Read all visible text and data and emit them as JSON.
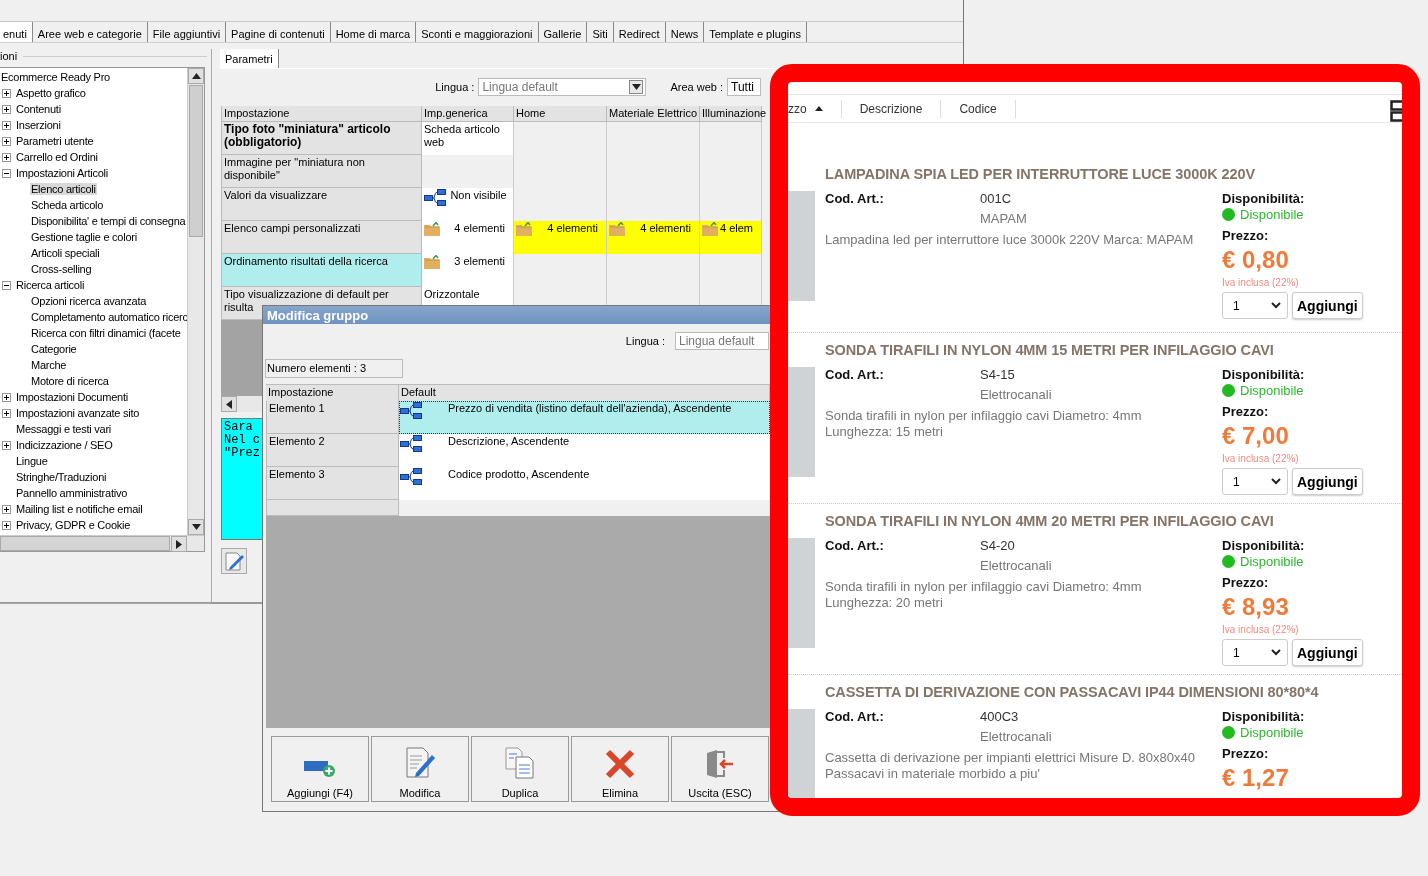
{
  "main_tabs": [
    {
      "label": "enuti",
      "selected": true
    },
    {
      "label": "Aree web e categorie",
      "selected": false
    },
    {
      "label": "File aggiuntivi",
      "selected": false
    },
    {
      "label": "Pagine di contenuti",
      "selected": false
    },
    {
      "label": "Home di marca",
      "selected": false
    },
    {
      "label": "Sconti e maggiorazioni",
      "selected": false
    },
    {
      "label": "Gallerie",
      "selected": false
    },
    {
      "label": "Siti",
      "selected": false
    },
    {
      "label": "Redirect",
      "selected": false
    },
    {
      "label": "News",
      "selected": false
    },
    {
      "label": "Template e plugins",
      "selected": false
    }
  ],
  "tree": {
    "group_label": "ioni",
    "items": [
      {
        "label": "Ecommerce Ready Pro",
        "selected": false,
        "children": [
          {
            "label": "Aspetto grafico",
            "selected": false,
            "expanded": false
          },
          {
            "label": "Contenuti",
            "selected": false,
            "expanded": false
          },
          {
            "label": "Inserzioni",
            "selected": false,
            "expanded": false
          },
          {
            "label": "Parametri utente",
            "selected": false,
            "expanded": false
          },
          {
            "label": "Carrello ed Ordini",
            "selected": false,
            "expanded": false
          },
          {
            "label": "Impostazioni Articoli",
            "selected": false,
            "expanded": true,
            "children": [
              {
                "label": "Elenco articoli",
                "selected": true
              },
              {
                "label": "Scheda articolo",
                "selected": false
              },
              {
                "label": "Disponibilita' e tempi di consegna",
                "selected": false
              },
              {
                "label": "Gestione taglie e colori",
                "selected": false
              },
              {
                "label": "Articoli speciali",
                "selected": false
              },
              {
                "label": "Cross-selling",
                "selected": false
              }
            ]
          },
          {
            "label": "Ricerca articoli",
            "selected": false,
            "expanded": true,
            "children": [
              {
                "label": "Opzioni ricerca avanzata",
                "selected": false
              },
              {
                "label": "Completamento automatico ricerc",
                "selected": false
              },
              {
                "label": "Ricerca con filtri dinamici (facete",
                "selected": false
              },
              {
                "label": "Categorie",
                "selected": false
              },
              {
                "label": "Marche",
                "selected": false
              },
              {
                "label": "Motore di ricerca",
                "selected": false
              }
            ]
          },
          {
            "label": "Impostazioni Documenti",
            "selected": false,
            "expanded": false
          },
          {
            "label": "Impostazioni avanzate sito",
            "selected": false,
            "expanded": false
          },
          {
            "label": "Messaggi e testi vari",
            "selected": false
          },
          {
            "label": "Indicizzazione / SEO",
            "selected": false,
            "expanded": false
          },
          {
            "label": "Lingue",
            "selected": false
          },
          {
            "label": "Stringhe/Traduzioni",
            "selected": false
          },
          {
            "label": "Pannello amministrativo",
            "selected": false
          },
          {
            "label": "Mailing list e notifiche email",
            "selected": false,
            "expanded": false
          },
          {
            "label": "Privacy, GDPR e Cookie",
            "selected": false,
            "expanded": false
          }
        ]
      }
    ]
  },
  "settings": {
    "tab": {
      "label": "Parametri",
      "selected": true
    },
    "language_label": "Lingua :",
    "language": "Lingua default",
    "web_area_label": "Area web :",
    "web_area": "Tutti",
    "columns": [
      "Impostazione",
      "Imp.generica",
      "Home",
      "Materiale Elettrico",
      "Illuminazione"
    ],
    "rows": [
      {
        "cells": [
          {
            "kind": "setting",
            "text": "Tipo foto \"miniatura\" articolo (obbligatorio)",
            "bold": true,
            "selected": false
          },
          {
            "kind": "text",
            "text": "Scheda articolo web",
            "highlighted": false
          },
          {
            "kind": "empty",
            "highlighted": false
          },
          {
            "kind": "empty",
            "highlighted": false
          },
          {
            "kind": "empty",
            "highlighted": false
          }
        ]
      },
      {
        "cells": [
          {
            "kind": "setting",
            "text": "Immagine per \"miniatura non disponibile\"",
            "bold": false,
            "selected": false
          },
          {
            "kind": "empty",
            "highlighted": false
          },
          {
            "kind": "empty",
            "highlighted": false
          },
          {
            "kind": "empty",
            "highlighted": false
          },
          {
            "kind": "empty",
            "highlighted": false
          }
        ]
      },
      {
        "cells": [
          {
            "kind": "setting",
            "text": "Valori da visualizzare",
            "bold": false,
            "selected": false
          },
          {
            "kind": "tree",
            "text": "Non visibile",
            "highlighted": false
          },
          {
            "kind": "empty",
            "highlighted": false
          },
          {
            "kind": "empty",
            "highlighted": false
          },
          {
            "kind": "empty",
            "highlighted": false
          }
        ]
      },
      {
        "cells": [
          {
            "kind": "setting",
            "text": "Elenco campi personalizzati",
            "bold": false,
            "selected": false
          },
          {
            "kind": "folder",
            "text": "4 elementi",
            "highlighted": false
          },
          {
            "kind": "folder",
            "text": "4 elementi",
            "highlighted": true
          },
          {
            "kind": "folder",
            "text": "4 elementi",
            "highlighted": true
          },
          {
            "kind": "folder",
            "text": "4 elem",
            "highlighted": true
          }
        ]
      },
      {
        "cells": [
          {
            "kind": "setting",
            "text": "Ordinamento risultati della ricerca",
            "bold": false,
            "selected": true
          },
          {
            "kind": "folder",
            "text": "3 elementi",
            "highlighted": false
          },
          {
            "kind": "empty",
            "highlighted": false
          },
          {
            "kind": "empty",
            "highlighted": false
          },
          {
            "kind": "empty",
            "highlighted": false
          }
        ]
      },
      {
        "cells": [
          {
            "kind": "setting",
            "text": "Tipo visualizzazione di default per risulta",
            "bold": false,
            "selected": false
          },
          {
            "kind": "text",
            "text": "Orizzontale",
            "highlighted": false
          },
          {
            "kind": "empty",
            "highlighted": false
          },
          {
            "kind": "empty",
            "highlighted": false
          },
          {
            "kind": "empty",
            "highlighted": false
          }
        ]
      }
    ],
    "notes": [
      "Sara",
      "Nel c",
      "\"Prez"
    ]
  },
  "dialog": {
    "title": "Modifica gruppo",
    "language_label": "Lingua :",
    "language": "Lingua default",
    "count": "Numero elementi : 3",
    "columns": [
      "Impostazione",
      "Default"
    ],
    "rows": [
      {
        "label": "Elemento 1",
        "value": "Prezzo di vendita (listino default dell'azienda), Ascendente",
        "selected": true
      },
      {
        "label": "Elemento 2",
        "value": "Descrizione, Ascendente",
        "selected": false
      },
      {
        "label": "Elemento 3",
        "value": "Codice prodotto, Ascendente",
        "selected": false
      }
    ],
    "buttons": [
      {
        "label": "Aggiungi (F4)",
        "kind": "add"
      },
      {
        "label": "Modifica",
        "kind": "edit"
      },
      {
        "label": "Duplica",
        "kind": "copy"
      },
      {
        "label": "Elimina",
        "kind": "delete"
      },
      {
        "label": "Uscita (ESC)",
        "kind": "exit"
      }
    ]
  },
  "shop": {
    "sort": [
      {
        "label": "zzo",
        "sorted": true
      },
      {
        "label": "Descrizione",
        "sorted": false
      },
      {
        "label": "Codice",
        "sorted": false
      }
    ],
    "products": [
      {
        "title": "LAMPADINA SPIA LED PER INTERRUTTORE LUCE 3000K 220V",
        "code_label": "Cod. Art.:",
        "code": "001C",
        "brand": "MAPAM",
        "description": "Lampadina led per interruttore luce 3000k 220V Marca: MAPAM",
        "availability_label": "Disponibilità:",
        "availability": "Disponibile",
        "color": "#22bb22",
        "price_label": "Prezzo:",
        "price": "€ 0,80",
        "vat": "Iva inclusa (22%)",
        "quantity": "1",
        "add_button": "Aggiungi"
      },
      {
        "title": "SONDA TIRAFILI IN NYLON 4MM 15 METRI PER INFILAGGIO CAVI",
        "code_label": "Cod. Art.:",
        "code": "S4-15",
        "brand": "Elettrocanali",
        "description": "Sonda tirafili in nylon per infilaggio cavi Diametro: 4mm Lunghezza: 15 metri",
        "availability_label": "Disponibilità:",
        "availability": "Disponibile",
        "color": "#22bb22",
        "price_label": "Prezzo:",
        "price": "€ 7,00",
        "vat": "Iva inclusa (22%)",
        "quantity": "1",
        "add_button": "Aggiungi"
      },
      {
        "title": "SONDA TIRAFILI IN NYLON 4MM 20 METRI PER INFILAGGIO CAVI",
        "code_label": "Cod. Art.:",
        "code": "S4-20",
        "brand": "Elettrocanali",
        "description": "Sonda tirafili in nylon per infilaggio cavi Diametro: 4mm Lunghezza: 20 metri",
        "availability_label": "Disponibilità:",
        "availability": "Disponibile",
        "color": "#22bb22",
        "price_label": "Prezzo:",
        "price": "€ 8,93",
        "vat": "Iva inclusa (22%)",
        "quantity": "1",
        "add_button": "Aggiungi"
      },
      {
        "title": "CASSETTA DI DERIVAZIONE CON PASSACAVI IP44 DIMENSIONI 80*80*4",
        "code_label": "Cod. Art.:",
        "code": "400C3",
        "brand": "Elettrocanali",
        "description": "Cassetta di derivazione per impianti elettrici Misure D. 80x80x40 Passacavi in materiale morbido a piu'",
        "availability_label": "Disponibilità:",
        "availability": "Disponibile",
        "color": "#22bb22",
        "price_label": "Prezzo:",
        "price": "€ 1,27"
      }
    ]
  }
}
